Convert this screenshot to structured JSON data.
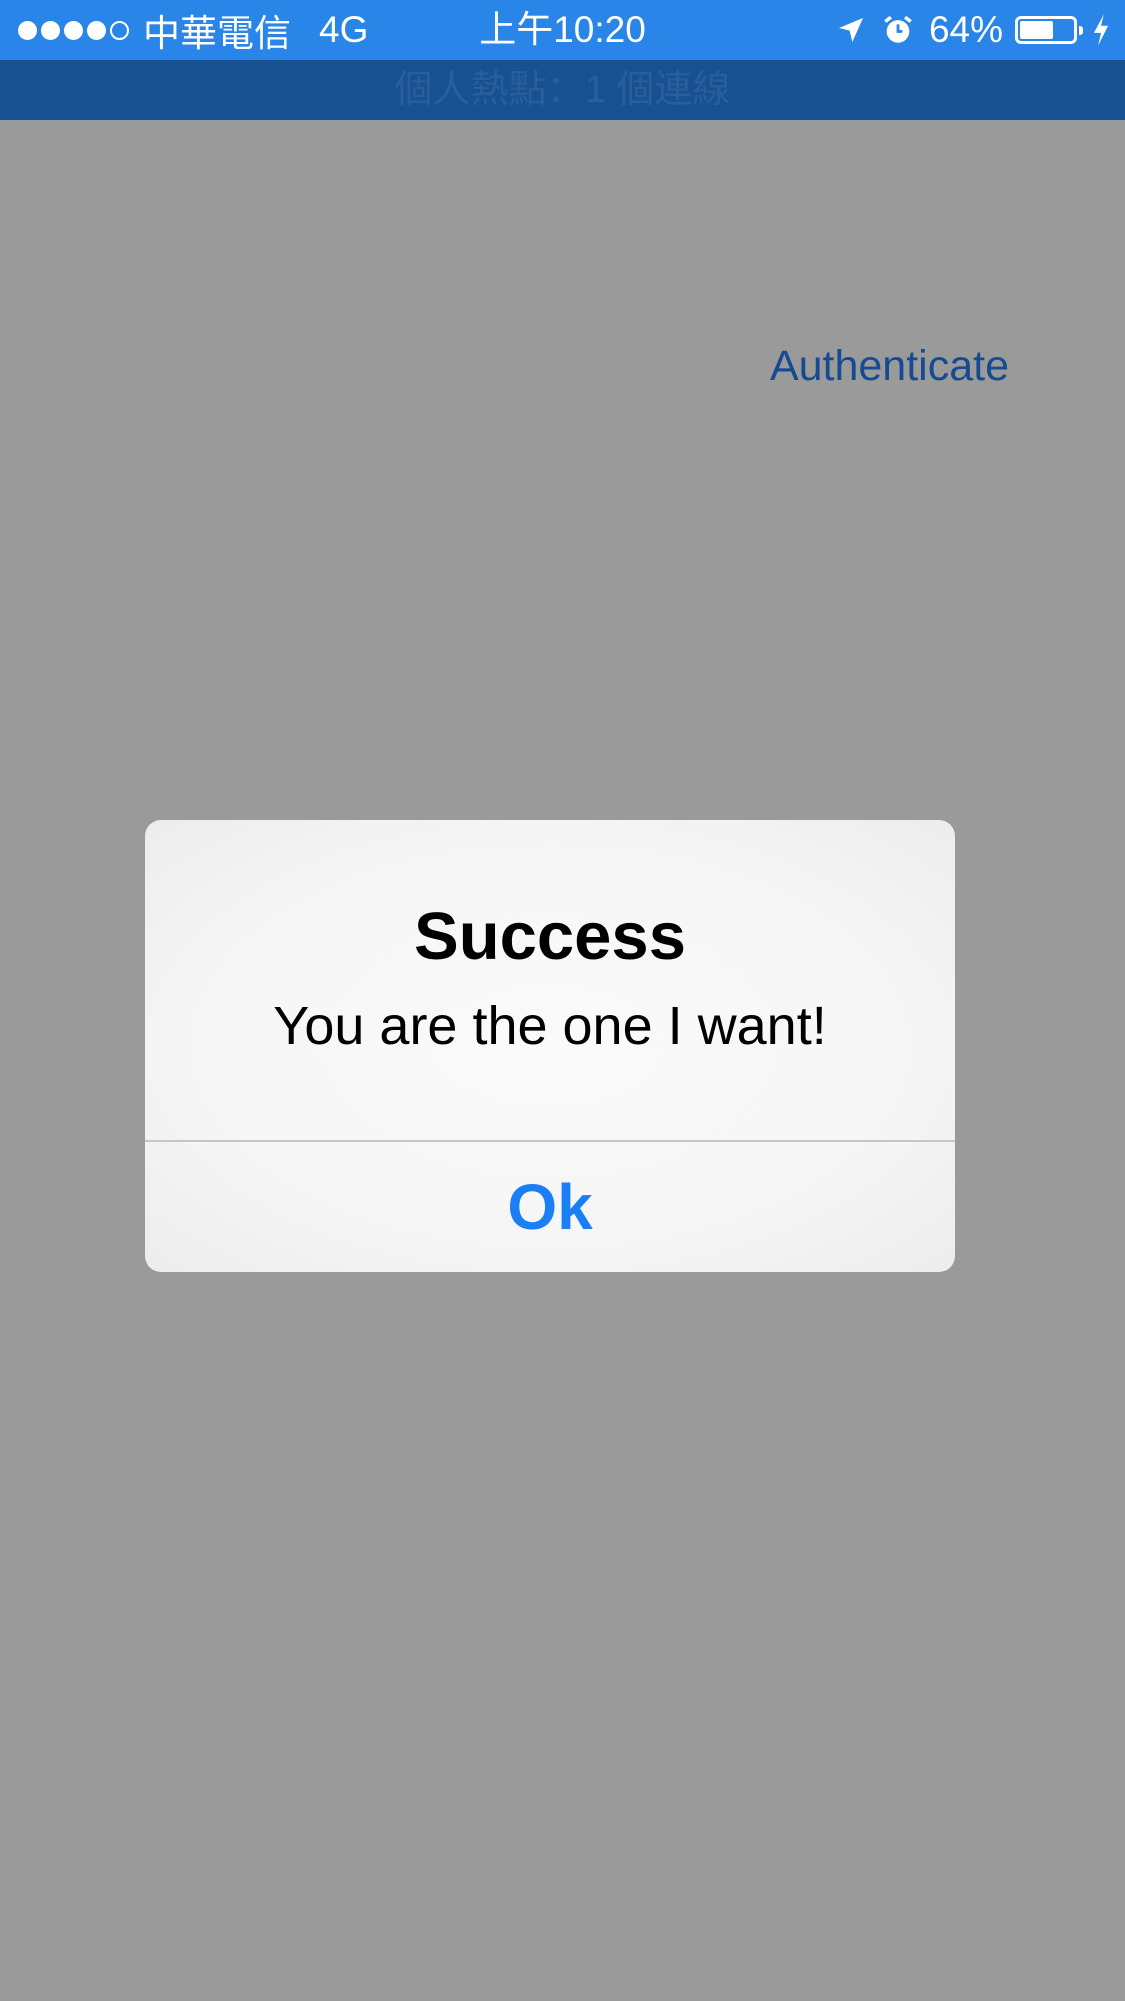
{
  "status_bar": {
    "signal": {
      "filled": 4,
      "total": 5
    },
    "carrier": "中華電信",
    "network": "4G",
    "time": "上午10:20",
    "battery_percent": "64%",
    "battery_level": 0.64,
    "icons": [
      "location-arrow-icon",
      "alarm-clock-icon",
      "battery-icon",
      "charging-bolt-icon"
    ],
    "background_color": "#2a85e8"
  },
  "hotspot_bar": {
    "text": "個人熱點：1 個連線",
    "background_color": "#175192"
  },
  "main": {
    "authenticate_label": "Authenticate",
    "background_color": "#9a9a9a"
  },
  "alert": {
    "title": "Success",
    "message": "You are the one I want!",
    "ok_label": "Ok",
    "button_color": "#1a7ff5"
  }
}
